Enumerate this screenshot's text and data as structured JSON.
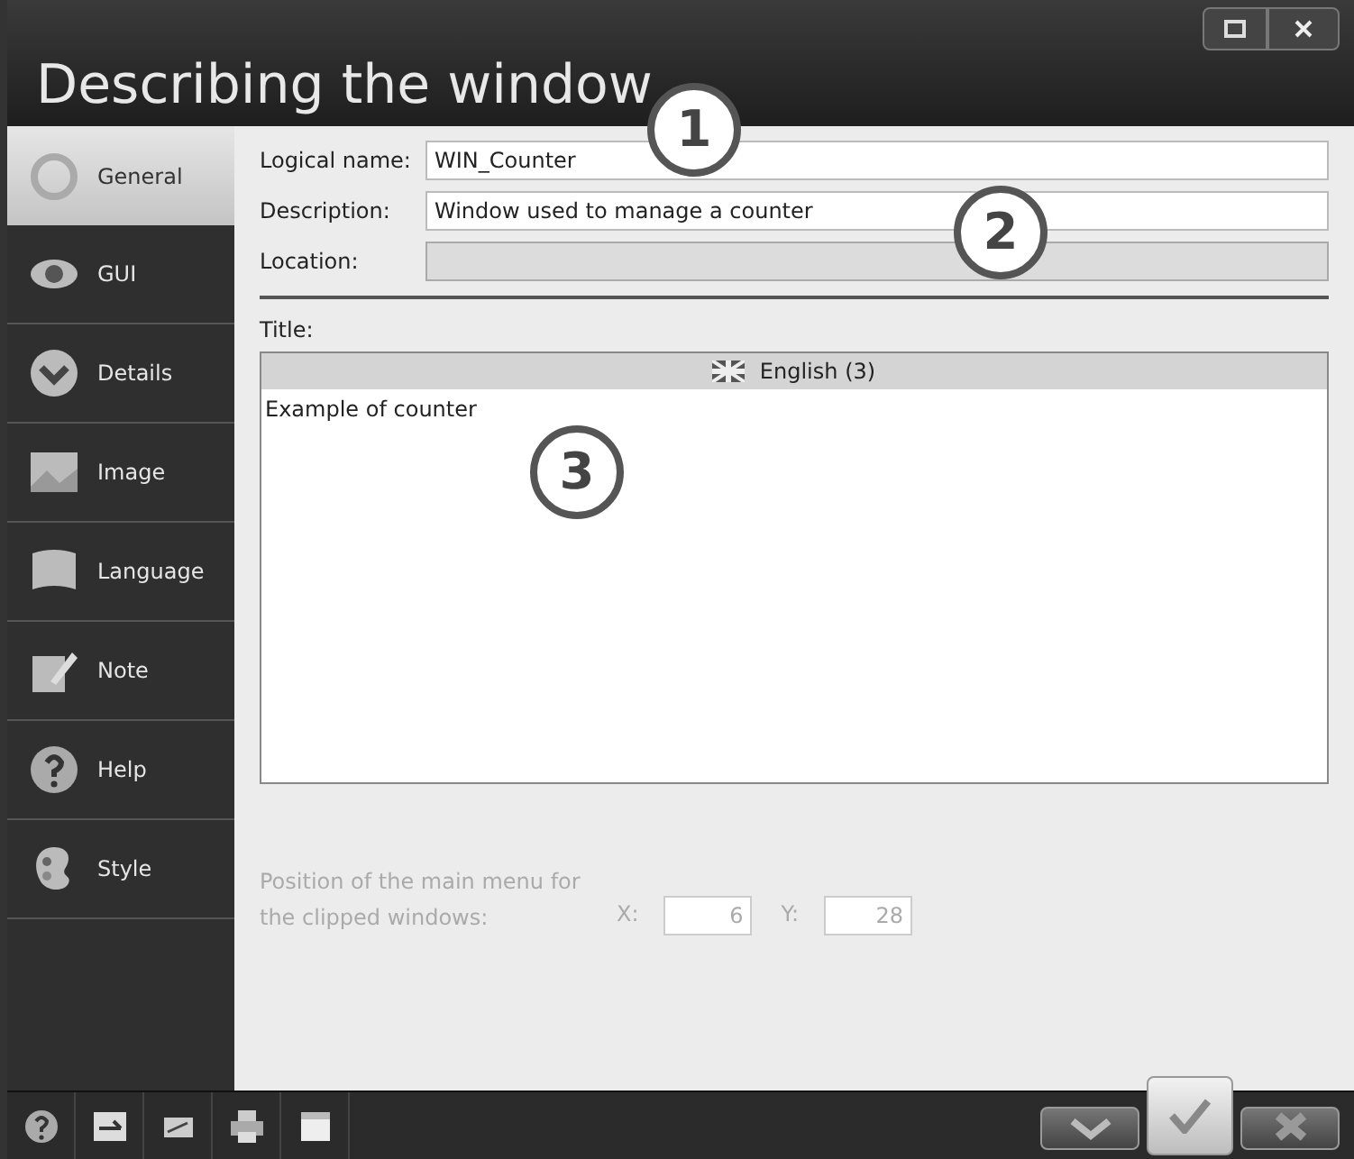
{
  "window": {
    "title": "Describing the window"
  },
  "sidebar": {
    "items": [
      {
        "label": "General",
        "kind": "ring",
        "selected": true
      },
      {
        "label": "GUI",
        "kind": "eye",
        "selected": false
      },
      {
        "label": "Details",
        "kind": "chevron",
        "selected": false
      },
      {
        "label": "Image",
        "kind": "image",
        "selected": false
      },
      {
        "label": "Language",
        "kind": "flag",
        "selected": false
      },
      {
        "label": "Note",
        "kind": "note",
        "selected": false
      },
      {
        "label": "Help",
        "kind": "help",
        "selected": false
      },
      {
        "label": "Style",
        "kind": "palette",
        "selected": false
      }
    ]
  },
  "form": {
    "fields": [
      {
        "label": "Logical name:",
        "value": "WIN_Counter",
        "disabled": false
      },
      {
        "label": "Description:",
        "value": "Window used to manage a counter",
        "disabled": false
      },
      {
        "label": "Location:",
        "disabled": true
      }
    ],
    "title_label": "Title:",
    "language_header": "English (3)",
    "title_text": "Example of counter",
    "position": {
      "label": "Position of the main menu for the clipped windows:",
      "disabled": true,
      "x_label": "X:",
      "x_value": "6",
      "y_label": "Y:",
      "y_value": "28"
    }
  },
  "callouts": [
    "1",
    "2",
    "3"
  ],
  "toolbar": {
    "buttons": [
      {
        "kind": "down",
        "selected": false
      },
      {
        "kind": "ok",
        "selected": true
      },
      {
        "kind": "cancel",
        "selected": false
      }
    ]
  }
}
